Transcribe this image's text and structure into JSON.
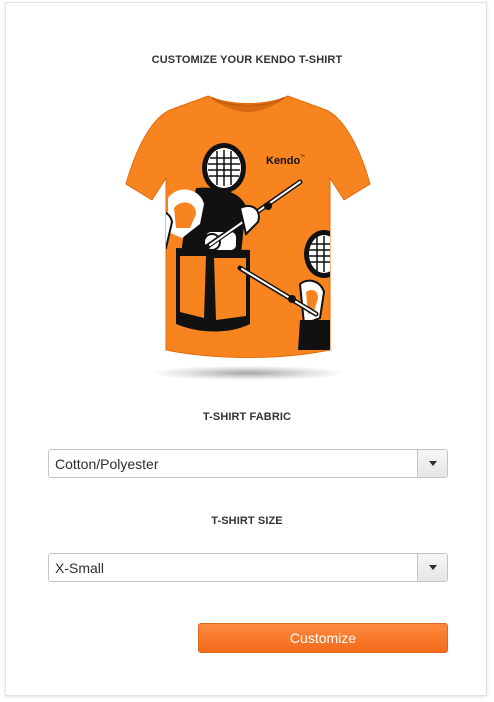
{
  "header": {
    "title": "CUSTOMIZE YOUR KENDO T-SHIRT"
  },
  "product": {
    "brand_text": "Kendo",
    "brand_mark": "™",
    "shirt_color": "#f7841f"
  },
  "fabric": {
    "label": "T-SHIRT FABRIC",
    "selected": "Cotton/Polyester"
  },
  "size": {
    "label": "T-SHIRT SIZE",
    "selected": "X-Small"
  },
  "actions": {
    "customize_label": "Customize"
  },
  "colors": {
    "accent": "#f46a1a",
    "border": "#c5c5c5",
    "text": "#333333"
  },
  "icons": {
    "dropdown": "chevron-down-icon"
  }
}
